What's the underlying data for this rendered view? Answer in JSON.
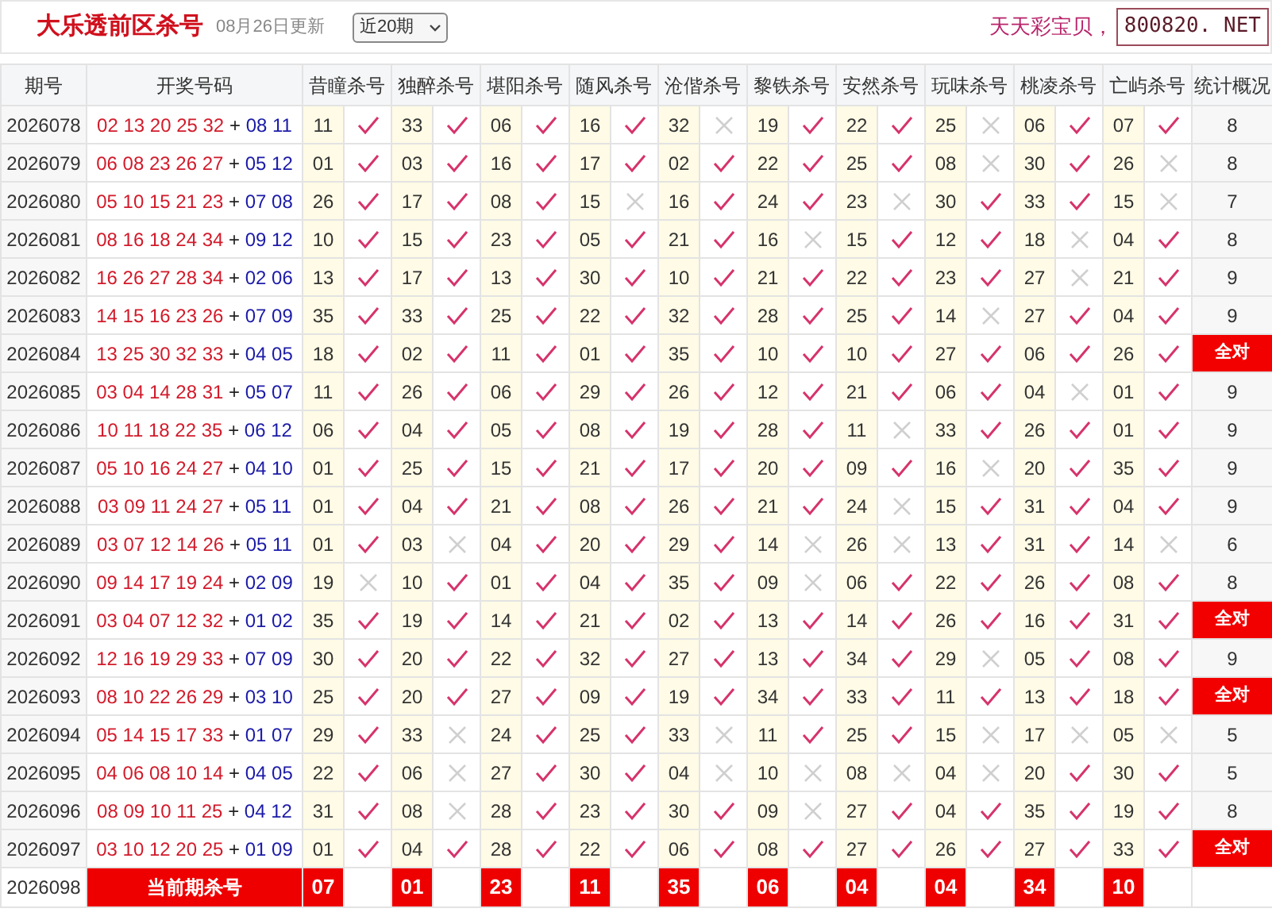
{
  "header": {
    "title": "大乐透前区杀号",
    "updated": "08月26日更新",
    "period_select": "近20期",
    "slogan": "天天彩宝贝，",
    "site": "800820. NET"
  },
  "table": {
    "columns": [
      "期号",
      "开奖号码",
      "昔瞳杀号",
      "独醉杀号",
      "堪阳杀号",
      "随风杀号",
      "沧偕杀号",
      "黎铁杀号",
      "安然杀号",
      "玩味杀号",
      "桃凌杀号",
      "亡屿杀号",
      "统计概况"
    ],
    "rows": [
      {
        "period": "2026078",
        "draw": {
          "front": "02 13 20 25 32",
          "sep": "+",
          "back": "08 11"
        },
        "picks": [
          {
            "num": "11",
            "hit": true
          },
          {
            "num": "33",
            "hit": true
          },
          {
            "num": "06",
            "hit": true
          },
          {
            "num": "16",
            "hit": true
          },
          {
            "num": "32",
            "hit": false
          },
          {
            "num": "19",
            "hit": true
          },
          {
            "num": "22",
            "hit": true
          },
          {
            "num": "25",
            "hit": false
          },
          {
            "num": "06",
            "hit": true
          },
          {
            "num": "07",
            "hit": true
          }
        ],
        "stat": "8",
        "all_correct": false
      },
      {
        "period": "2026079",
        "draw": {
          "front": "06 08 23 26 27",
          "sep": "+",
          "back": "05 12"
        },
        "picks": [
          {
            "num": "01",
            "hit": true
          },
          {
            "num": "03",
            "hit": true
          },
          {
            "num": "16",
            "hit": true
          },
          {
            "num": "17",
            "hit": true
          },
          {
            "num": "02",
            "hit": true
          },
          {
            "num": "22",
            "hit": true
          },
          {
            "num": "25",
            "hit": true
          },
          {
            "num": "08",
            "hit": false
          },
          {
            "num": "30",
            "hit": true
          },
          {
            "num": "26",
            "hit": false
          }
        ],
        "stat": "8",
        "all_correct": false
      },
      {
        "period": "2026080",
        "draw": {
          "front": "05 10 15 21 23",
          "sep": "+",
          "back": "07 08"
        },
        "picks": [
          {
            "num": "26",
            "hit": true
          },
          {
            "num": "17",
            "hit": true
          },
          {
            "num": "08",
            "hit": true
          },
          {
            "num": "15",
            "hit": false
          },
          {
            "num": "16",
            "hit": true
          },
          {
            "num": "24",
            "hit": true
          },
          {
            "num": "23",
            "hit": false
          },
          {
            "num": "30",
            "hit": true
          },
          {
            "num": "33",
            "hit": true
          },
          {
            "num": "15",
            "hit": false
          }
        ],
        "stat": "7",
        "all_correct": false
      },
      {
        "period": "2026081",
        "draw": {
          "front": "08 16 18 24 34",
          "sep": "+",
          "back": "09 12"
        },
        "picks": [
          {
            "num": "10",
            "hit": true
          },
          {
            "num": "15",
            "hit": true
          },
          {
            "num": "23",
            "hit": true
          },
          {
            "num": "05",
            "hit": true
          },
          {
            "num": "21",
            "hit": true
          },
          {
            "num": "16",
            "hit": false
          },
          {
            "num": "15",
            "hit": true
          },
          {
            "num": "12",
            "hit": true
          },
          {
            "num": "18",
            "hit": false
          },
          {
            "num": "04",
            "hit": true
          }
        ],
        "stat": "8",
        "all_correct": false
      },
      {
        "period": "2026082",
        "draw": {
          "front": "16 26 27 28 34",
          "sep": "+",
          "back": "02 06"
        },
        "picks": [
          {
            "num": "13",
            "hit": true
          },
          {
            "num": "17",
            "hit": true
          },
          {
            "num": "13",
            "hit": true
          },
          {
            "num": "30",
            "hit": true
          },
          {
            "num": "10",
            "hit": true
          },
          {
            "num": "21",
            "hit": true
          },
          {
            "num": "22",
            "hit": true
          },
          {
            "num": "23",
            "hit": true
          },
          {
            "num": "27",
            "hit": false
          },
          {
            "num": "21",
            "hit": true
          }
        ],
        "stat": "9",
        "all_correct": false
      },
      {
        "period": "2026083",
        "draw": {
          "front": "14 15 16 23 26",
          "sep": "+",
          "back": "07 09"
        },
        "picks": [
          {
            "num": "35",
            "hit": true
          },
          {
            "num": "33",
            "hit": true
          },
          {
            "num": "25",
            "hit": true
          },
          {
            "num": "22",
            "hit": true
          },
          {
            "num": "32",
            "hit": true
          },
          {
            "num": "28",
            "hit": true
          },
          {
            "num": "25",
            "hit": true
          },
          {
            "num": "14",
            "hit": false
          },
          {
            "num": "27",
            "hit": true
          },
          {
            "num": "04",
            "hit": true
          }
        ],
        "stat": "9",
        "all_correct": false
      },
      {
        "period": "2026084",
        "draw": {
          "front": "13 25 30 32 33",
          "sep": "+",
          "back": "04 05"
        },
        "picks": [
          {
            "num": "18",
            "hit": true
          },
          {
            "num": "02",
            "hit": true
          },
          {
            "num": "11",
            "hit": true
          },
          {
            "num": "01",
            "hit": true
          },
          {
            "num": "35",
            "hit": true
          },
          {
            "num": "10",
            "hit": true
          },
          {
            "num": "10",
            "hit": true
          },
          {
            "num": "27",
            "hit": true
          },
          {
            "num": "06",
            "hit": true
          },
          {
            "num": "26",
            "hit": true
          }
        ],
        "stat": "全对",
        "all_correct": true
      },
      {
        "period": "2026085",
        "draw": {
          "front": "03 04 14 28 31",
          "sep": "+",
          "back": "05 07"
        },
        "picks": [
          {
            "num": "11",
            "hit": true
          },
          {
            "num": "26",
            "hit": true
          },
          {
            "num": "06",
            "hit": true
          },
          {
            "num": "29",
            "hit": true
          },
          {
            "num": "26",
            "hit": true
          },
          {
            "num": "12",
            "hit": true
          },
          {
            "num": "21",
            "hit": true
          },
          {
            "num": "06",
            "hit": true
          },
          {
            "num": "04",
            "hit": false
          },
          {
            "num": "01",
            "hit": true
          }
        ],
        "stat": "9",
        "all_correct": false
      },
      {
        "period": "2026086",
        "draw": {
          "front": "10 11 18 22 35",
          "sep": "+",
          "back": "06 12"
        },
        "picks": [
          {
            "num": "06",
            "hit": true
          },
          {
            "num": "04",
            "hit": true
          },
          {
            "num": "05",
            "hit": true
          },
          {
            "num": "08",
            "hit": true
          },
          {
            "num": "19",
            "hit": true
          },
          {
            "num": "28",
            "hit": true
          },
          {
            "num": "11",
            "hit": false
          },
          {
            "num": "33",
            "hit": true
          },
          {
            "num": "26",
            "hit": true
          },
          {
            "num": "01",
            "hit": true
          }
        ],
        "stat": "9",
        "all_correct": false
      },
      {
        "period": "2026087",
        "draw": {
          "front": "05 10 16 24 27",
          "sep": "+",
          "back": "04 10"
        },
        "picks": [
          {
            "num": "01",
            "hit": true
          },
          {
            "num": "25",
            "hit": true
          },
          {
            "num": "15",
            "hit": true
          },
          {
            "num": "21",
            "hit": true
          },
          {
            "num": "17",
            "hit": true
          },
          {
            "num": "20",
            "hit": true
          },
          {
            "num": "09",
            "hit": true
          },
          {
            "num": "16",
            "hit": false
          },
          {
            "num": "20",
            "hit": true
          },
          {
            "num": "35",
            "hit": true
          }
        ],
        "stat": "9",
        "all_correct": false
      },
      {
        "period": "2026088",
        "draw": {
          "front": "03 09 11 24 27",
          "sep": "+",
          "back": "05 11"
        },
        "picks": [
          {
            "num": "01",
            "hit": true
          },
          {
            "num": "04",
            "hit": true
          },
          {
            "num": "21",
            "hit": true
          },
          {
            "num": "08",
            "hit": true
          },
          {
            "num": "26",
            "hit": true
          },
          {
            "num": "21",
            "hit": true
          },
          {
            "num": "24",
            "hit": false
          },
          {
            "num": "15",
            "hit": true
          },
          {
            "num": "31",
            "hit": true
          },
          {
            "num": "04",
            "hit": true
          }
        ],
        "stat": "9",
        "all_correct": false
      },
      {
        "period": "2026089",
        "draw": {
          "front": "03 07 12 14 26",
          "sep": "+",
          "back": "05 11"
        },
        "picks": [
          {
            "num": "01",
            "hit": true
          },
          {
            "num": "03",
            "hit": false
          },
          {
            "num": "04",
            "hit": true
          },
          {
            "num": "20",
            "hit": true
          },
          {
            "num": "29",
            "hit": true
          },
          {
            "num": "14",
            "hit": false
          },
          {
            "num": "26",
            "hit": false
          },
          {
            "num": "13",
            "hit": true
          },
          {
            "num": "31",
            "hit": true
          },
          {
            "num": "14",
            "hit": false
          }
        ],
        "stat": "6",
        "all_correct": false
      },
      {
        "period": "2026090",
        "draw": {
          "front": "09 14 17 19 24",
          "sep": "+",
          "back": "02 09"
        },
        "picks": [
          {
            "num": "19",
            "hit": false
          },
          {
            "num": "10",
            "hit": true
          },
          {
            "num": "01",
            "hit": true
          },
          {
            "num": "04",
            "hit": true
          },
          {
            "num": "35",
            "hit": true
          },
          {
            "num": "09",
            "hit": false
          },
          {
            "num": "06",
            "hit": true
          },
          {
            "num": "22",
            "hit": true
          },
          {
            "num": "26",
            "hit": true
          },
          {
            "num": "08",
            "hit": true
          }
        ],
        "stat": "8",
        "all_correct": false
      },
      {
        "period": "2026091",
        "draw": {
          "front": "03 04 07 12 32",
          "sep": "+",
          "back": "01 02"
        },
        "picks": [
          {
            "num": "35",
            "hit": true
          },
          {
            "num": "19",
            "hit": true
          },
          {
            "num": "14",
            "hit": true
          },
          {
            "num": "21",
            "hit": true
          },
          {
            "num": "02",
            "hit": true
          },
          {
            "num": "13",
            "hit": true
          },
          {
            "num": "14",
            "hit": true
          },
          {
            "num": "26",
            "hit": true
          },
          {
            "num": "16",
            "hit": true
          },
          {
            "num": "31",
            "hit": true
          }
        ],
        "stat": "全对",
        "all_correct": true
      },
      {
        "period": "2026092",
        "draw": {
          "front": "12 16 19 29 33",
          "sep": "+",
          "back": "07 09"
        },
        "picks": [
          {
            "num": "30",
            "hit": true
          },
          {
            "num": "20",
            "hit": true
          },
          {
            "num": "22",
            "hit": true
          },
          {
            "num": "32",
            "hit": true
          },
          {
            "num": "27",
            "hit": true
          },
          {
            "num": "13",
            "hit": true
          },
          {
            "num": "34",
            "hit": true
          },
          {
            "num": "29",
            "hit": false
          },
          {
            "num": "05",
            "hit": true
          },
          {
            "num": "08",
            "hit": true
          }
        ],
        "stat": "9",
        "all_correct": false
      },
      {
        "period": "2026093",
        "draw": {
          "front": "08 10 22 26 29",
          "sep": "+",
          "back": "03 10"
        },
        "picks": [
          {
            "num": "25",
            "hit": true
          },
          {
            "num": "20",
            "hit": true
          },
          {
            "num": "27",
            "hit": true
          },
          {
            "num": "09",
            "hit": true
          },
          {
            "num": "19",
            "hit": true
          },
          {
            "num": "34",
            "hit": true
          },
          {
            "num": "33",
            "hit": true
          },
          {
            "num": "11",
            "hit": true
          },
          {
            "num": "13",
            "hit": true
          },
          {
            "num": "18",
            "hit": true
          }
        ],
        "stat": "全对",
        "all_correct": true
      },
      {
        "period": "2026094",
        "draw": {
          "front": "05 14 15 17 33",
          "sep": "+",
          "back": "01 07"
        },
        "picks": [
          {
            "num": "29",
            "hit": true
          },
          {
            "num": "33",
            "hit": false
          },
          {
            "num": "24",
            "hit": true
          },
          {
            "num": "25",
            "hit": true
          },
          {
            "num": "33",
            "hit": false
          },
          {
            "num": "11",
            "hit": true
          },
          {
            "num": "25",
            "hit": true
          },
          {
            "num": "15",
            "hit": false
          },
          {
            "num": "17",
            "hit": false
          },
          {
            "num": "05",
            "hit": false
          }
        ],
        "stat": "5",
        "all_correct": false
      },
      {
        "period": "2026095",
        "draw": {
          "front": "04 06 08 10 14",
          "sep": "+",
          "back": "04 05"
        },
        "picks": [
          {
            "num": "22",
            "hit": true
          },
          {
            "num": "06",
            "hit": false
          },
          {
            "num": "27",
            "hit": true
          },
          {
            "num": "30",
            "hit": true
          },
          {
            "num": "04",
            "hit": false
          },
          {
            "num": "10",
            "hit": false
          },
          {
            "num": "08",
            "hit": false
          },
          {
            "num": "04",
            "hit": false
          },
          {
            "num": "20",
            "hit": true
          },
          {
            "num": "30",
            "hit": true
          }
        ],
        "stat": "5",
        "all_correct": false
      },
      {
        "period": "2026096",
        "draw": {
          "front": "08 09 10 11 25",
          "sep": "+",
          "back": "04 12"
        },
        "picks": [
          {
            "num": "31",
            "hit": true
          },
          {
            "num": "08",
            "hit": false
          },
          {
            "num": "28",
            "hit": true
          },
          {
            "num": "23",
            "hit": true
          },
          {
            "num": "30",
            "hit": true
          },
          {
            "num": "09",
            "hit": false
          },
          {
            "num": "27",
            "hit": true
          },
          {
            "num": "04",
            "hit": true
          },
          {
            "num": "35",
            "hit": true
          },
          {
            "num": "19",
            "hit": true
          }
        ],
        "stat": "8",
        "all_correct": false
      },
      {
        "period": "2026097",
        "draw": {
          "front": "03 10 12 20 25",
          "sep": "+",
          "back": "01 09"
        },
        "picks": [
          {
            "num": "01",
            "hit": true
          },
          {
            "num": "04",
            "hit": true
          },
          {
            "num": "28",
            "hit": true
          },
          {
            "num": "22",
            "hit": true
          },
          {
            "num": "06",
            "hit": true
          },
          {
            "num": "08",
            "hit": true
          },
          {
            "num": "27",
            "hit": true
          },
          {
            "num": "26",
            "hit": true
          },
          {
            "num": "27",
            "hit": true
          },
          {
            "num": "33",
            "hit": true
          }
        ],
        "stat": "全对",
        "all_correct": true
      }
    ],
    "current": {
      "period": "2026098",
      "label": "当前期杀号",
      "picks": [
        "07",
        "01",
        "23",
        "11",
        "35",
        "06",
        "04",
        "04",
        "34",
        "10"
      ]
    }
  }
}
